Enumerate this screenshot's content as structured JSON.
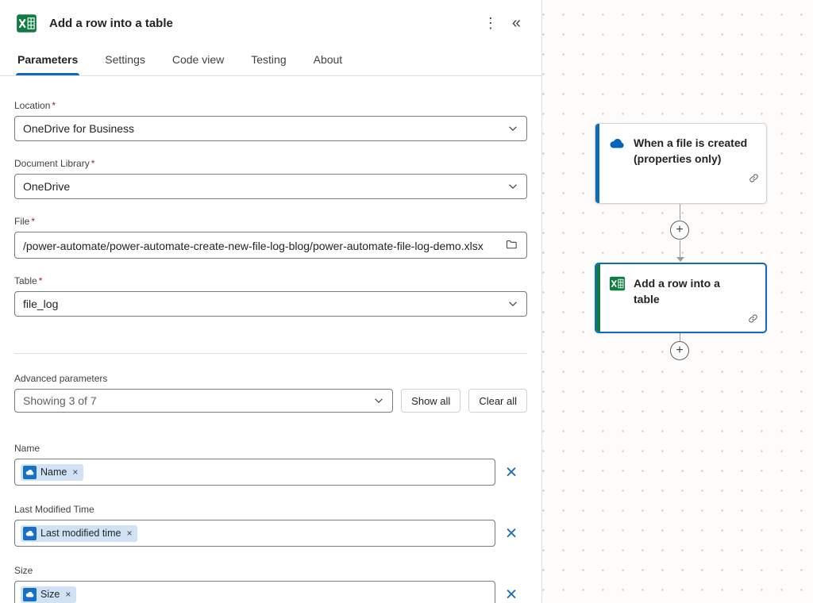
{
  "header": {
    "title": "Add a row into a table",
    "menu_icon": "⋮",
    "collapse_icon": "«"
  },
  "tabs": [
    {
      "label": "Parameters"
    },
    {
      "label": "Settings"
    },
    {
      "label": "Code view"
    },
    {
      "label": "Testing"
    },
    {
      "label": "About"
    }
  ],
  "required_mark": "*",
  "fields": {
    "location": {
      "label": "Location",
      "value": "OneDrive for Business"
    },
    "library": {
      "label": "Document Library",
      "value": "OneDrive"
    },
    "file": {
      "label": "File",
      "value": "/power-automate/power-automate-create-new-file-log-blog/power-automate-file-log-demo.xlsx"
    },
    "table": {
      "label": "Table",
      "value": "file_log"
    }
  },
  "advanced": {
    "label": "Advanced parameters",
    "selected": "Showing 3 of 7",
    "show_all_label": "Show all",
    "clear_all_label": "Clear all"
  },
  "dynamic_fields": [
    {
      "label": "Name",
      "token": "Name"
    },
    {
      "label": "Last Modified Time",
      "token": "Last modified time"
    },
    {
      "label": "Size",
      "token": "Size"
    }
  ],
  "token_dismiss": "×",
  "remove_icon": "×",
  "canvas": {
    "cards": [
      {
        "title": "When a file is created (properties only)"
      },
      {
        "title": "Add a row into a table"
      }
    ],
    "plus_icon": "+"
  },
  "colors": {
    "accent_blue": "#0f6cbd",
    "excel_green": "#107c41",
    "onedrive_blue": "#0364b8"
  }
}
